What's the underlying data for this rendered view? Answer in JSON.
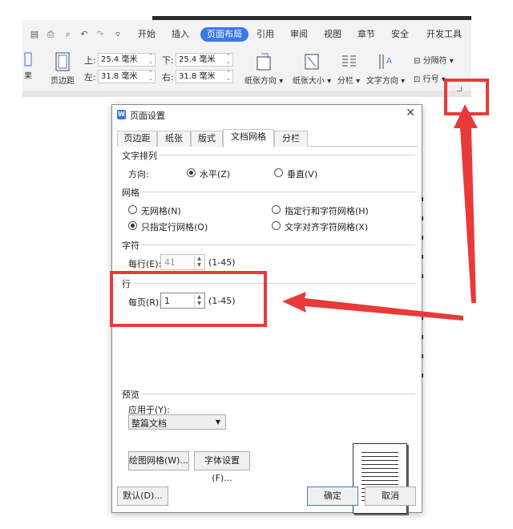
{
  "toolbar": {
    "tabs": [
      "开始",
      "插入",
      "页面布局",
      "引用",
      "审阅",
      "视图",
      "章节",
      "安全",
      "开发工具"
    ],
    "active_tab": "页面布局",
    "margins": {
      "top_label": "上:",
      "top_value": "25.4 毫米",
      "bottom_label": "下:",
      "bottom_value": "25.4 毫米",
      "left_label": "左:",
      "left_value": "31.8 毫米",
      "right_label": "右:",
      "right_value": "31.8 毫米"
    },
    "buttons": {
      "margins": "页边距",
      "orientation": "纸张方向",
      "size": "纸张大小",
      "columns": "分栏",
      "text_direction": "文字方向",
      "separator": "分隔符",
      "line_numbers": "行号"
    },
    "left_cut_label": "果"
  },
  "dialog": {
    "title": "页面设置",
    "close": "✕",
    "tabs": [
      "页边距",
      "纸张",
      "版式",
      "文档网格",
      "分栏"
    ],
    "active_tab": "文档网格",
    "text_layout": {
      "heading": "文字排列",
      "direction_label": "方向:",
      "horizontal": "水平(Z)",
      "vertical": "垂直(V)",
      "selected": "horizontal"
    },
    "grid": {
      "heading": "网格",
      "no_grid": "无网格(N)",
      "line_char_grid": "指定行和字符网格(H)",
      "line_grid_only": "只指定行网格(O)",
      "snap_char_grid": "文字对齐字符网格(X)",
      "selected": "line_grid_only"
    },
    "chars": {
      "heading": "字符",
      "per_line_label": "每行(E):",
      "per_line_value": "41",
      "range": "(1-45)"
    },
    "lines": {
      "heading": "行",
      "per_page_label": "每页(R):",
      "per_page_value": "1",
      "range": "(1-45)"
    },
    "preview": {
      "heading": "预览",
      "apply_label": "应用于(Y):",
      "apply_value": "整篇文档"
    },
    "buttons": {
      "draw_grid": "绘图网格(W)...",
      "font_settings": "字体设置(F)...",
      "default": "默认(D)...",
      "ok": "确定",
      "cancel": "取消"
    }
  },
  "annotation": {
    "color": "#e83a3a"
  }
}
